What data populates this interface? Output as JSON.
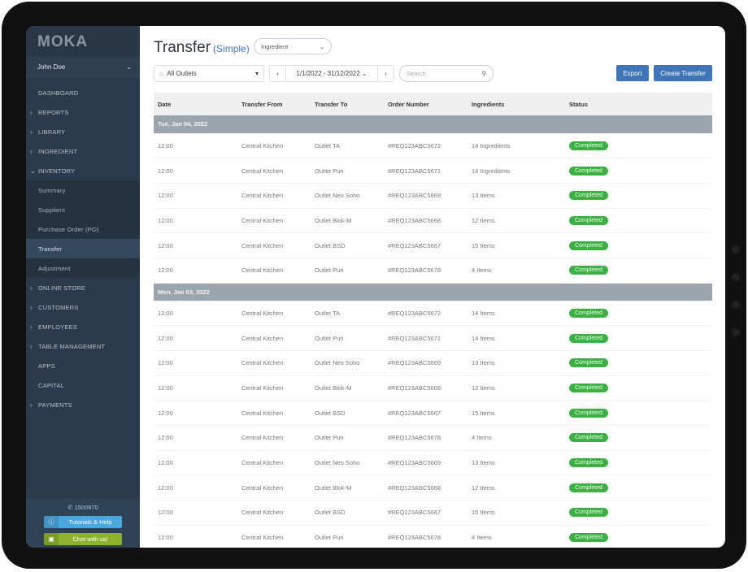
{
  "brand": "MOKA",
  "user": "John Doe",
  "nav": [
    {
      "label": "DASHBOARD",
      "chev": ""
    },
    {
      "label": "REPORTS",
      "chev": ">"
    },
    {
      "label": "LIBRARY",
      "chev": ">"
    },
    {
      "label": "INGREDIENT",
      "chev": ">"
    },
    {
      "label": "INVENTORY",
      "chev": "v"
    },
    {
      "label": "Summary",
      "sub": true
    },
    {
      "label": "Suppliers",
      "sub": true
    },
    {
      "label": "Purchase Order (PO)",
      "sub": true
    },
    {
      "label": "Transfer",
      "sub": true,
      "active": true
    },
    {
      "label": "Adjustment",
      "sub": true
    },
    {
      "label": "ONLINE STORE",
      "chev": ">"
    },
    {
      "label": "CUSTOMERS",
      "chev": ">"
    },
    {
      "label": "EMPLOYEES",
      "chev": ">"
    },
    {
      "label": "TABLE MANAGEMENT",
      "chev": ">"
    },
    {
      "label": "APPS",
      "chev": ""
    },
    {
      "label": "CAPITAL",
      "chev": ""
    },
    {
      "label": "PAYMENTS",
      "chev": ">"
    }
  ],
  "footer": {
    "phone": "1500970",
    "tutorials": "Tutorials & Help",
    "chat": "Chat with us!",
    "tutorials_color": "#4aa8e0",
    "chat_color": "#8db32d"
  },
  "header": {
    "title": "Transfer",
    "subtitle": "(Simple)",
    "type_select": "Ingredient",
    "outlet": "All Outlets",
    "date_range": "1/1/2022 - 31/12/2022",
    "search_placeholder": "Search",
    "export": "Export",
    "create": "Create Transfer",
    "accent": "#3f75b9"
  },
  "columns": [
    "Date",
    "Transfer From",
    "Transfer To",
    "Order Number",
    "Ingredients",
    "Status"
  ],
  "groups": [
    {
      "date": "Tue, Jan 04, 2022",
      "rows": [
        [
          "12:00",
          "Central Kitchen",
          "Outlet TA",
          "#REQ123ABC5672",
          "14 Ingredients",
          "Completed"
        ],
        [
          "12:00",
          "Central Kitchen",
          "Outlet Puri",
          "#REQ123ABC5671",
          "14 Ingredients",
          "Completed"
        ],
        [
          "12:00",
          "Central Kitchen",
          "Outlet Neo Soho",
          "#REQ123ABC5669",
          "13 Items",
          "Completed"
        ],
        [
          "12:00",
          "Central Kitchen",
          "Outlet Blok-M",
          "#REQ123ABC5668",
          "12 Items",
          "Completed"
        ],
        [
          "12:00",
          "Central Kitchen",
          "Outlet BSD",
          "#REQ123ABC5667",
          "15 Items",
          "Completed"
        ],
        [
          "12:00",
          "Central Kitchen",
          "Outlet Puri",
          "#REQ123ABC5678",
          "4 Items",
          "Completed"
        ]
      ]
    },
    {
      "date": "Mon, Jan 03, 2022",
      "rows": [
        [
          "12:00",
          "Central Kitchen",
          "Outlet TA",
          "#REQ123ABC5672",
          "14 Items",
          "Completed"
        ],
        [
          "12:00",
          "Central Kitchen",
          "Outlet Puri",
          "#REQ123ABC5671",
          "14 Items",
          "Completed"
        ],
        [
          "12:00",
          "Central Kitchen",
          "Outlet Neo Soho",
          "#REQ123ABC5669",
          "13 Items",
          "Completed"
        ],
        [
          "12:00",
          "Central Kitchen",
          "Outlet Blok-M",
          "#REQ123ABC5668",
          "12 Items",
          "Completed"
        ],
        [
          "12:00",
          "Central Kitchen",
          "Outlet BSD",
          "#REQ123ABC5667",
          "15 Items",
          "Completed"
        ],
        [
          "12:00",
          "Central Kitchen",
          "Outlet Puri",
          "#REQ123ABC5678",
          "4 Items",
          "Completed"
        ],
        [
          "12:00",
          "Central Kitchen",
          "Outlet Neo Soho",
          "#REQ123ABC5669",
          "13 Items",
          "Completed"
        ],
        [
          "12:00",
          "Central Kitchen",
          "Outlet Blok-M",
          "#REQ123ABC5668",
          "12 Items",
          "Completed"
        ],
        [
          "12:00",
          "Central Kitchen",
          "Outlet BSD",
          "#REQ123ABC5667",
          "15 Items",
          "Completed"
        ],
        [
          "12:00",
          "Central Kitchen",
          "Outlet Puri",
          "#REQ123ABC5678",
          "4 Items",
          "Completed"
        ]
      ]
    }
  ]
}
